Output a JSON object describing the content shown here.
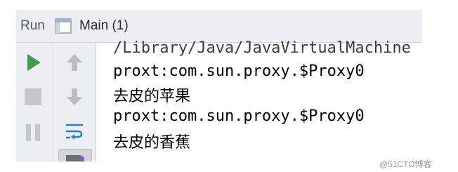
{
  "header": {
    "run_label": "Run",
    "tab_icon": "window-icon",
    "tab_label": "Main (1)"
  },
  "toolbar": {
    "left_icons": [
      "run-icon",
      "stop-icon",
      "pause-icon"
    ],
    "mid_icons": [
      "up-arrow-icon",
      "down-arrow-icon",
      "soft-wrap-icon",
      "print-icon"
    ]
  },
  "console": {
    "lines": [
      "/Library/Java/JavaVirtualMachine",
      "proxt:com.sun.proxy.$Proxy0",
      "去皮的苹果",
      "proxt:com.sun.proxy.$Proxy0",
      "去皮的香蕉"
    ]
  },
  "watermark": "@51CTO博客",
  "colors": {
    "run_green": "#3aa14a",
    "toolbar_bg": "#eceef1",
    "icon_gray": "#bcbcbc"
  }
}
